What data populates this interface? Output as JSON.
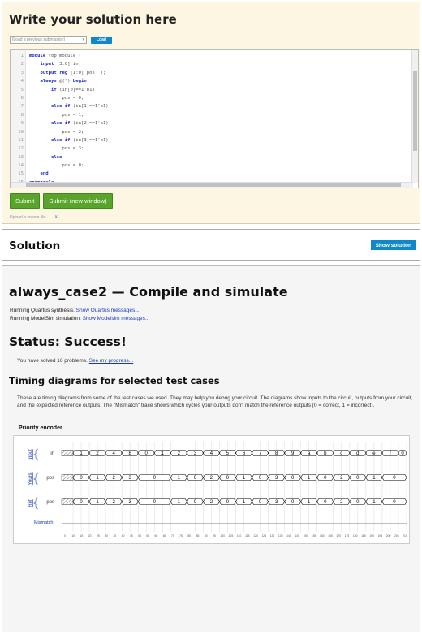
{
  "editor_panel": {
    "title": "Write your solution here",
    "load_select": "[Load a previous submission]",
    "load_button": "Load",
    "code_lines": [
      [
        {
          "t": "module",
          "k": 1
        },
        {
          "t": " top_module ("
        }
      ],
      [
        {
          "t": "    "
        },
        {
          "t": "input",
          "k": 1
        },
        {
          "t": " [3:0] in,"
        }
      ],
      [
        {
          "t": "    "
        },
        {
          "t": "output",
          "k": 1
        },
        {
          "t": " "
        },
        {
          "t": "reg",
          "k": 1
        },
        {
          "t": " [1:0] pos  );"
        }
      ],
      [
        {
          "t": "    "
        },
        {
          "t": "always",
          "k": 1
        },
        {
          "t": " @(*) "
        },
        {
          "t": "begin",
          "k": 1
        }
      ],
      [
        {
          "t": "        "
        },
        {
          "t": "if",
          "k": 1
        },
        {
          "t": " (in[0]==1'b1)"
        }
      ],
      [
        {
          "t": "            pos = 0;"
        }
      ],
      [
        {
          "t": "        "
        },
        {
          "t": "else if",
          "k": 1
        },
        {
          "t": " (in[1]==1'b1)"
        }
      ],
      [
        {
          "t": "            pos = 1;"
        }
      ],
      [
        {
          "t": "        "
        },
        {
          "t": "else if",
          "k": 1
        },
        {
          "t": " (in[2]==1'b1)"
        }
      ],
      [
        {
          "t": "            pos = 2;"
        }
      ],
      [
        {
          "t": "        "
        },
        {
          "t": "else if",
          "k": 1
        },
        {
          "t": " (in[3]==1'b1)"
        }
      ],
      [
        {
          "t": "            pos = 3;"
        }
      ],
      [
        {
          "t": "        "
        },
        {
          "t": "else",
          "k": 1
        }
      ],
      [
        {
          "t": "            pos = 0;"
        }
      ],
      [
        {
          "t": "    "
        },
        {
          "t": "end",
          "k": 1
        }
      ],
      [
        {
          "t": "endmodule",
          "k": 1
        }
      ]
    ],
    "submit_button": "Submit",
    "submit_new_window_button": "Submit (new window)",
    "upload_link": "Upload a source file..."
  },
  "solution_panel": {
    "title": "Solution",
    "show_button": "Show solution"
  },
  "results": {
    "title": "always_case2 — Compile and simulate",
    "quartus_text": "Running Quartus synthesis. ",
    "quartus_link": "Show Quartus messages...",
    "modelsim_text": "Running ModelSim simulation. ",
    "modelsim_link": "Show Modelsim messages...",
    "status": "Status: Success!",
    "solved_text": "You have solved 16 problems. ",
    "progress_link": "See my progress...",
    "timing_title": "Timing diagrams for selected test cases",
    "timing_desc": "These are timing diagrams from some of the test cases we used. They may help you debug your circuit. The diagrams show inputs to the circuit, outputs from your circuit, and the expected reference outputs. The \"Mismatch\" trace shows which cycles your outputs don't match the reference outputs (0 = correct, 1 = incorrect).",
    "waveform": {
      "title": "Priority encoder",
      "group_labels": {
        "input": "Input",
        "yours": "Yours",
        "ref": "Ref"
      },
      "signals": {
        "in": "in",
        "pos_yours": "pos",
        "pos_ref": "pos",
        "mismatch": "Mismatch:"
      },
      "in_values": [
        "1",
        "2",
        "4",
        "8",
        "0",
        "1",
        "2",
        "3",
        "4",
        "5",
        "6",
        "7",
        "8",
        "9",
        "a",
        "b",
        "c",
        "d",
        "e",
        "f",
        "0"
      ],
      "pos_values": [
        "0",
        "1",
        "2",
        "3",
        "0",
        "1",
        "0",
        "2",
        "0",
        "1",
        "0",
        "3",
        "0",
        "1",
        "0",
        "2",
        "0",
        "1",
        "0"
      ],
      "pos_spans": [
        1,
        1,
        1,
        1,
        2,
        1,
        1,
        1,
        1,
        1,
        1,
        1,
        1,
        1,
        1,
        1,
        1,
        1,
        2
      ],
      "time_ticks": [
        "0",
        "10",
        "15",
        "20",
        "25",
        "30",
        "35",
        "40",
        "45",
        "50",
        "55",
        "60",
        "65",
        "70",
        "75",
        "80",
        "85",
        "90",
        "95",
        "100",
        "105",
        "110",
        "115",
        "120",
        "125",
        "130",
        "135",
        "140",
        "145",
        "150",
        "155",
        "160",
        "165",
        "170",
        "175",
        "180",
        "185",
        "190",
        "195",
        "200",
        "205",
        "210"
      ],
      "colors": {
        "bus_fill": "#ffffff",
        "bus_stroke": "#000000",
        "unknown_hatch": "#888888",
        "grid": "#d0d0d0",
        "group_label": "#1a3bb5"
      }
    }
  }
}
